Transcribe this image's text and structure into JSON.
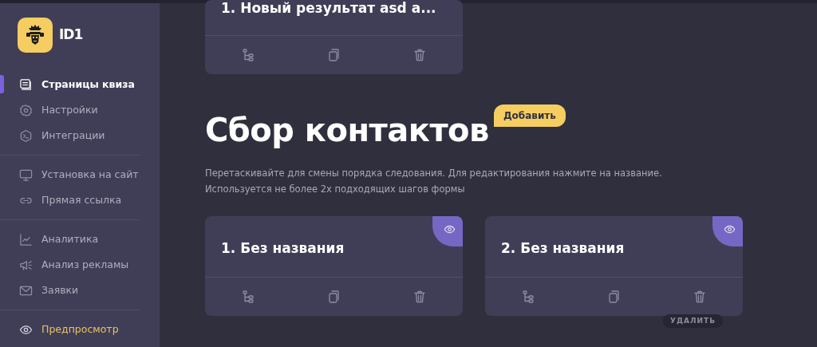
{
  "logo": {
    "text": "ID1"
  },
  "sidebar": {
    "groups": [
      {
        "items": [
          {
            "label": "Страницы квиза",
            "selected": true,
            "kind": "nav"
          },
          {
            "label": "Настройки",
            "selected": false,
            "kind": "nav"
          },
          {
            "label": "Интеграции",
            "selected": false,
            "kind": "nav"
          }
        ]
      },
      {
        "items": [
          {
            "label": "Установка на сайт",
            "selected": false,
            "kind": "nav"
          },
          {
            "label": "Прямая ссылка",
            "selected": false,
            "kind": "nav"
          }
        ]
      },
      {
        "items": [
          {
            "label": "Аналитика",
            "selected": false,
            "kind": "nav"
          },
          {
            "label": "Анализ рекламы",
            "selected": false,
            "kind": "nav"
          },
          {
            "label": "Заявки",
            "selected": false,
            "kind": "nav"
          }
        ]
      },
      {
        "items": [
          {
            "label": "Предпросмотр",
            "selected": false,
            "kind": "preview"
          }
        ]
      }
    ]
  },
  "top_card": {
    "title": "1. Новый результат asd a..."
  },
  "section": {
    "title": "Сбор контактов",
    "add_button": "Добавить",
    "description": [
      "Перетаскивайте для смены порядка следования. Для редактирования нажмите на название.",
      "Используется не более 2х подходящих шагов формы"
    ]
  },
  "steps": [
    {
      "title": "1. Без названия",
      "preview": true
    },
    {
      "title": "2. Без названия",
      "preview": true,
      "tooltip": "УДАЛИТЬ"
    }
  ]
}
